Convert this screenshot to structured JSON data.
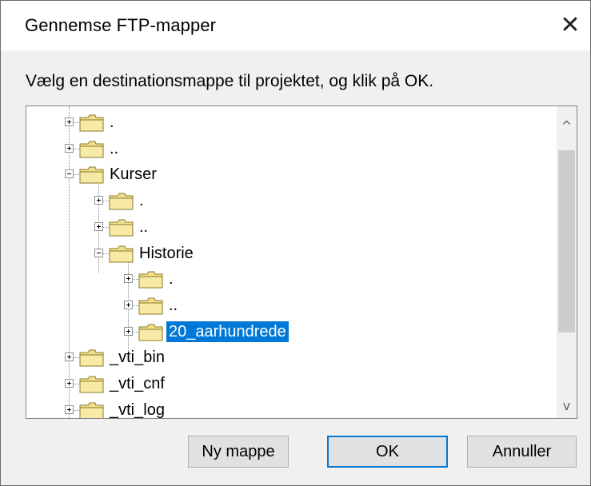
{
  "window": {
    "title": "Gennemse FTP-mapper",
    "close_glyph": "✕"
  },
  "instruction": "Vælg en destinationsmappe til projektet, og klik på OK.",
  "tree": {
    "items": [
      {
        "label": ".",
        "expander": "plus",
        "depth": 0,
        "selected": false
      },
      {
        "label": "..",
        "expander": "plus",
        "depth": 0,
        "selected": false
      },
      {
        "label": "Kurser",
        "expander": "minus",
        "depth": 0,
        "selected": false
      },
      {
        "label": ".",
        "expander": "plus",
        "depth": 1,
        "selected": false
      },
      {
        "label": "..",
        "expander": "plus",
        "depth": 1,
        "selected": false
      },
      {
        "label": "Historie",
        "expander": "minus",
        "depth": 1,
        "selected": false
      },
      {
        "label": ".",
        "expander": "plus",
        "depth": 2,
        "selected": false
      },
      {
        "label": "..",
        "expander": "plus",
        "depth": 2,
        "selected": false
      },
      {
        "label": "20_aarhundrede",
        "expander": "plus",
        "depth": 2,
        "selected": true
      },
      {
        "label": "_vti_bin",
        "expander": "plus",
        "depth": 0,
        "selected": false
      },
      {
        "label": "_vti_cnf",
        "expander": "plus",
        "depth": 0,
        "selected": false
      },
      {
        "label": "_vti_log",
        "expander": "plus",
        "depth": 0,
        "selected": false
      }
    ]
  },
  "scrollbar": {
    "up_glyph": "^",
    "down_glyph": "v"
  },
  "buttons": {
    "new_folder": "Ny mappe",
    "ok": "OK",
    "cancel": "Annuller"
  },
  "colors": {
    "selection": "#0078d7",
    "folder_fill": "#f3e08a",
    "folder_stroke": "#8a7a2a"
  },
  "icons": {
    "folder": "folder-icon",
    "close": "close-icon"
  }
}
